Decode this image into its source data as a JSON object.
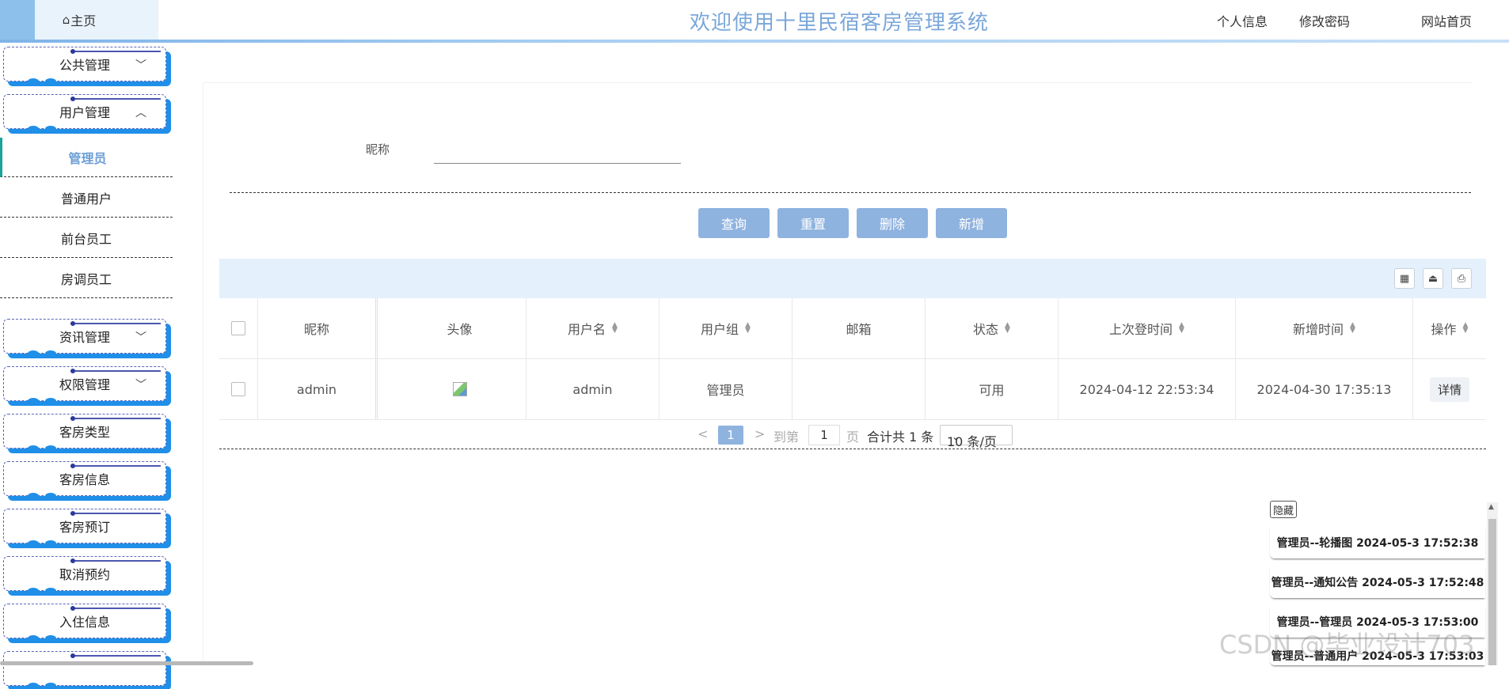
{
  "header": {
    "home_label": "主页",
    "title": "欢迎使用十里民宿客房管理系统",
    "links": [
      "个人信息",
      "修改密码",
      "网站首页"
    ]
  },
  "sidebar": {
    "groups": [
      {
        "label": "公共管理",
        "chev": "﹀"
      },
      {
        "label": "用户管理",
        "chev": "︿"
      },
      {
        "label": "资讯管理",
        "chev": "﹀"
      },
      {
        "label": "权限管理",
        "chev": "﹀"
      },
      {
        "label": "客房类型",
        "chev": ""
      },
      {
        "label": "客房信息",
        "chev": ""
      },
      {
        "label": "客房预订",
        "chev": ""
      },
      {
        "label": "取消预约",
        "chev": ""
      },
      {
        "label": "入住信息",
        "chev": ""
      }
    ],
    "sub_items": [
      "管理员",
      "普通用户",
      "前台员工",
      "房调员工"
    ],
    "active_sub": "管理员"
  },
  "search": {
    "label": "昵称",
    "value": ""
  },
  "actions": [
    "查询",
    "重置",
    "删除",
    "新增"
  ],
  "table": {
    "columns": [
      "昵称",
      "头像",
      "用户名",
      "用户组",
      "邮箱",
      "状态",
      "上次登时间",
      "新增时间",
      "操作"
    ],
    "rows": [
      {
        "nickname": "admin",
        "username": "admin",
        "group": "管理员",
        "email": "",
        "status": "可用",
        "last_login": "2024-04-12 22:53:34",
        "created": "2024-04-30 17:35:13",
        "action": "详情"
      }
    ]
  },
  "pager": {
    "prev": "<",
    "current": "1",
    "next": ">",
    "goto_prefix": "到第",
    "goto_value": "1",
    "goto_suffix": "页",
    "total": "合计共 1 条",
    "page_size": "10 条/页"
  },
  "log_panel": {
    "hide_label": "隐藏",
    "entries": [
      "管理员--轮播图 2024-05-3 17:52:38",
      "管理员--通知公告 2024-05-3 17:52:48",
      "管理员--管理员 2024-05-3 17:53:00",
      "管理员--普通用户 2024-05-3 17:53:03"
    ]
  },
  "watermark": "CSDN @毕业设计703"
}
